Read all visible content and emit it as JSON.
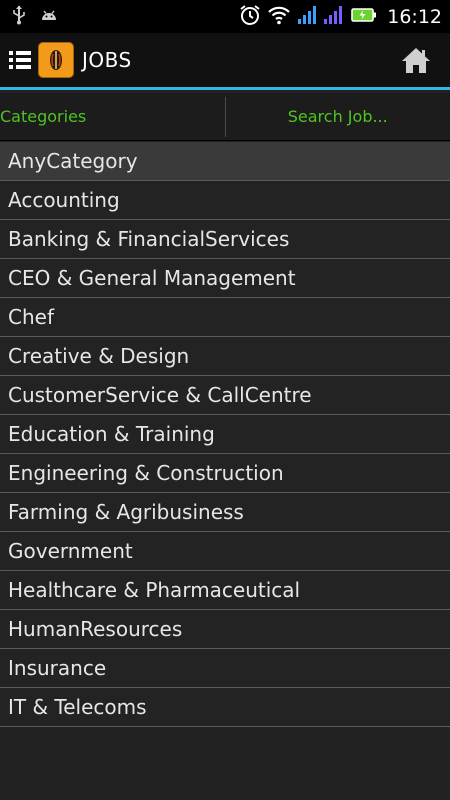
{
  "status_bar": {
    "time": "16:12",
    "icons": [
      "usb-icon",
      "android-debug-icon",
      "alarm-icon",
      "wifi-icon",
      "signal-icon",
      "signal-icon",
      "battery-charging-icon"
    ]
  },
  "action_bar": {
    "title": "JOBS",
    "menu_icon": "list-menu-icon",
    "logo_icon": "app-logo-icon",
    "home_icon": "home-icon"
  },
  "tabs": {
    "categories_label": "Categories",
    "search_label": "Search Job..."
  },
  "categories": [
    "AnyCategory",
    "Accounting",
    "Banking & FinancialServices",
    "CEO & General Management",
    "Chef",
    "Creative & Design",
    "CustomerService & CallCentre",
    "Education & Training",
    "Engineering & Construction",
    "Farming & Agribusiness",
    "Government",
    "Healthcare & Pharmaceutical",
    "HumanResources",
    "Insurance",
    "IT & Telecoms"
  ],
  "colors": {
    "accent": "#33b5e5",
    "tab_text": "#4fc422",
    "logo": "#f29a1a",
    "signal": "#3aa0ff",
    "signal_alt": "#7c5cff",
    "battery": "#6ad42f"
  }
}
